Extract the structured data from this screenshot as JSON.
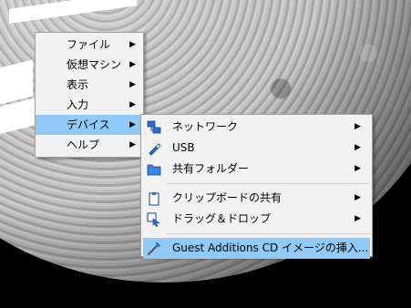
{
  "main_menu": {
    "items": [
      {
        "label": "ファイル",
        "has_submenu": true
      },
      {
        "label": "仮想マシン",
        "has_submenu": true
      },
      {
        "label": "表示",
        "has_submenu": true
      },
      {
        "label": "入力",
        "has_submenu": true
      },
      {
        "label": "デバイス",
        "has_submenu": true,
        "active": true
      },
      {
        "label": "ヘルプ",
        "has_submenu": true
      }
    ],
    "arrow_glyph": "▶"
  },
  "devices_submenu": {
    "items": [
      {
        "label": "ネットワーク",
        "icon": "network-icon",
        "has_submenu": true
      },
      {
        "label": "USB",
        "icon": "usb-icon",
        "has_submenu": true
      },
      {
        "label": "共有フォルダー",
        "icon": "folder-icon",
        "has_submenu": true
      },
      {
        "label": "クリップボードの共有",
        "icon": "clipboard-icon",
        "has_submenu": true
      },
      {
        "label": "ドラッグ＆ドロップ",
        "icon": "drag-drop-icon",
        "has_submenu": true
      },
      {
        "label": "Guest Additions CD イメージの挿入...",
        "icon": "cd-insert-icon",
        "has_submenu": false,
        "active": true
      }
    ],
    "arrow_glyph": "▶"
  },
  "colors": {
    "highlight": "#91c9f7",
    "menu_background": "#f2f2f2",
    "icon_blue": "#2b6fd6"
  }
}
